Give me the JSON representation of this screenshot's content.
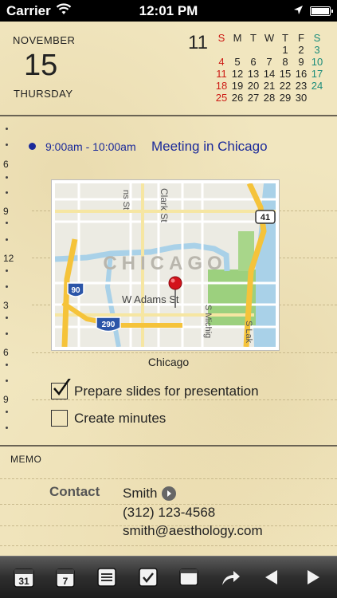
{
  "status_bar": {
    "carrier": "Carrier",
    "time": "12:01 PM"
  },
  "date_header": {
    "month": "NOVEMBER",
    "day": "15",
    "weekday": "THURSDAY"
  },
  "mini_calendar": {
    "month_number": "11",
    "weekday_headers": [
      "S",
      "M",
      "T",
      "W",
      "T",
      "F",
      "S"
    ],
    "weeks": [
      [
        "",
        "",
        "",
        "",
        "1",
        "2",
        "3"
      ],
      [
        "4",
        "5",
        "6",
        "7",
        "8",
        "9",
        "10"
      ],
      [
        "11",
        "12",
        "13",
        "14",
        "15",
        "16",
        "17"
      ],
      [
        "18",
        "19",
        "20",
        "21",
        "22",
        "23",
        "24"
      ],
      [
        "25",
        "26",
        "27",
        "28",
        "29",
        "30",
        ""
      ]
    ],
    "colors": {
      "sunday": "#cc1a14",
      "saturday": "#1a8c7a"
    }
  },
  "timeline": {
    "hour_labels": [
      "6",
      "9",
      "12",
      "3",
      "6",
      "9"
    ]
  },
  "event": {
    "time_range": "9:00am - 10:00am",
    "title": "Meeting in Chicago",
    "color": "#1b2a9a"
  },
  "map": {
    "city_label": "CHICAGO",
    "street_labels": [
      "ns St",
      "Clark St",
      "W Adams St",
      "S Michig",
      "S Lak"
    ],
    "highway_shields": [
      "41",
      "90",
      "290"
    ],
    "caption": "Chicago",
    "pin_icon": "map-pin-icon"
  },
  "checklist": [
    {
      "label": "Prepare slides for presentation",
      "checked": true
    },
    {
      "label": "Create minutes",
      "checked": false
    }
  ],
  "memo": {
    "label": "MEMO",
    "contact_label": "Contact",
    "contact_name": "Smith",
    "contact_phone": "(312) 123-4568",
    "contact_email": "smith@aesthology.com"
  },
  "toolbar": {
    "month_view_day": "31",
    "week_view_day": "7",
    "icons": [
      "month-view-icon",
      "week-view-icon",
      "list-view-icon",
      "todo-icon",
      "window-icon",
      "share-icon",
      "previous-icon",
      "next-icon"
    ]
  }
}
